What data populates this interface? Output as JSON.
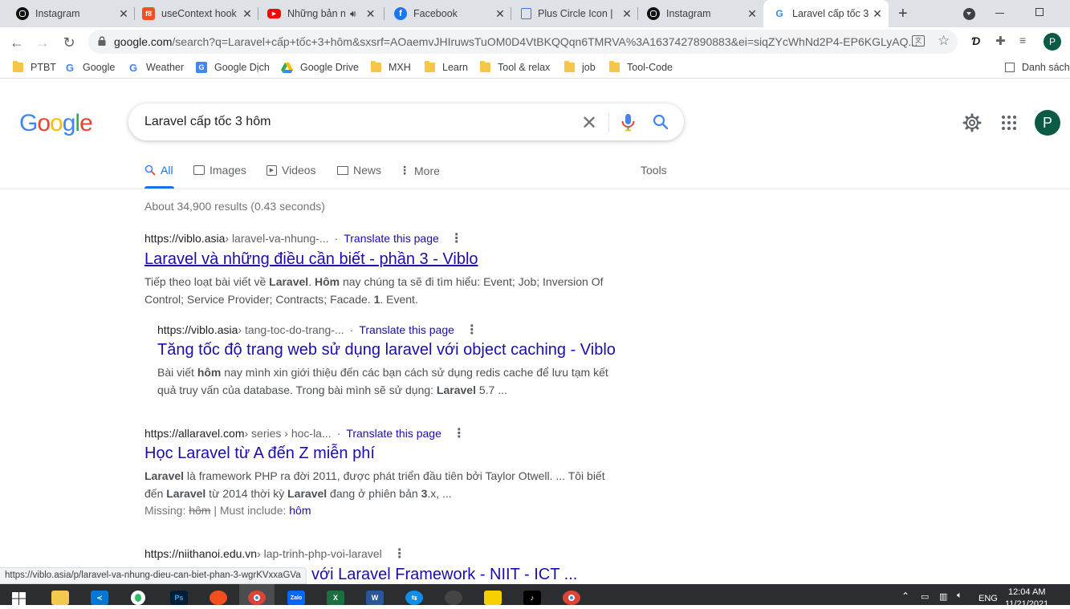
{
  "tabs": [
    {
      "title": "Instagram",
      "icon": "instagram-icon",
      "color": "#111111"
    },
    {
      "title": "useContext hook",
      "icon": "f8-icon",
      "color": "#f05123"
    },
    {
      "title": "Những bản n",
      "icon": "youtube-icon",
      "color": "#ff0000"
    },
    {
      "title": "Facebook",
      "icon": "facebook-icon",
      "color": "#1877f2"
    },
    {
      "title": "Plus Circle Icon | ",
      "icon": "flag-icon",
      "color": "#4a6ee0"
    },
    {
      "title": "Instagram",
      "icon": "instagram-icon",
      "color": "#111111"
    },
    {
      "title": "Laravel cấp tốc 3",
      "icon": "google-icon",
      "color": "#ffffff"
    }
  ],
  "address": {
    "host": "google.com",
    "rest": "/search?q=Laravel+cấp+tốc+3+hôm&sxsrf=AOaemvJHIruwsTuOM0D4VtBKQQqn6TMRVA%3A1637427890883&ei=siqZYcWhNd2P4-EP6KGLyAQ..."
  },
  "profile_initial": "P",
  "bookmarks": [
    {
      "label": "PTBT",
      "type": "folder"
    },
    {
      "label": "Google",
      "type": "google"
    },
    {
      "label": "Weather",
      "type": "google"
    },
    {
      "label": "Google Dịch",
      "type": "translate"
    },
    {
      "label": "Google Drive",
      "type": "drive"
    },
    {
      "label": "MXH",
      "type": "folder"
    },
    {
      "label": "Learn",
      "type": "folder"
    },
    {
      "label": "Tool & relax",
      "type": "folder"
    },
    {
      "label": "job",
      "type": "folder"
    },
    {
      "label": "Tool-Code",
      "type": "folder"
    }
  ],
  "reading_list": "Danh sách",
  "logo": [
    "G",
    "o",
    "o",
    "g",
    "l",
    "e"
  ],
  "logo_colors": [
    "#4285f4",
    "#ea4335",
    "#fbbc05",
    "#4285f4",
    "#34a853",
    "#ea4335"
  ],
  "search": {
    "query": "Laravel cấp tốc 3 hôm"
  },
  "nav_tabs": [
    "All",
    "Images",
    "Videos",
    "News",
    "More"
  ],
  "tools": "Tools",
  "stats": "About 34,900 results (0.43 seconds)",
  "results": [
    {
      "url": "https://viblo.asia",
      "path": " › laravel-va-nhung-...",
      "translate": "Translate this page",
      "title": "Laravel và những điều cần biết - phần 3 - Viblo",
      "snippet": [
        "Tiếp theo loạt bài viết về ",
        "Laravel",
        ". ",
        "Hôm",
        " nay chúng ta sẽ đi tìm hiểu: Event; Job; Inversion Of Control; Service Provider; Contracts; Facade. ",
        "1",
        ". Event."
      ]
    },
    {
      "url": "https://viblo.asia",
      "path": " › tang-toc-do-trang-...",
      "translate": "Translate this page",
      "title": "Tăng tốc độ trang web sử dụng laravel với object caching - Viblo",
      "snippet": [
        "Bài viết ",
        "hôm",
        " nay mình xin giới thiệu đến các bạn cách sử dụng redis cache để lưu tạm kết quả truy vấn của database. Trong bài mình sẽ sử dụng: ",
        "Laravel",
        " 5.7 ..."
      ]
    },
    {
      "url": "https://allaravel.com",
      "path": " › series › hoc-la...",
      "translate": "Translate this page",
      "title": "Học Laravel từ A đến Z miễn phí",
      "snippet": [
        "",
        "Laravel",
        " là framework PHP ra đời 2011, được phát triển đầu tiên bởi Taylor Otwell. ... Tôi biết đến ",
        "Laravel",
        " từ 2014 thời kỳ ",
        "Laravel",
        " đang ở phiên bản ",
        "3",
        ".x, ..."
      ],
      "missing_label": "Missing: ",
      "missing_word": "hôm",
      "must_label": " | Must include: ",
      "must_word": "hôm"
    },
    {
      "url": "https://niithanoi.edu.vn",
      "path": " › lap-trinh-php-voi-laravel",
      "title": "với Laravel Framework - NIIT - ICT ..."
    }
  ],
  "status_url": "https://viblo.asia/p/laravel-va-nhung-dieu-can-biet-phan-3-wgrKVxxaGVa",
  "taskbar": {
    "time": "12:04 AM",
    "date": "11/21/2021",
    "lang": "ENG"
  }
}
